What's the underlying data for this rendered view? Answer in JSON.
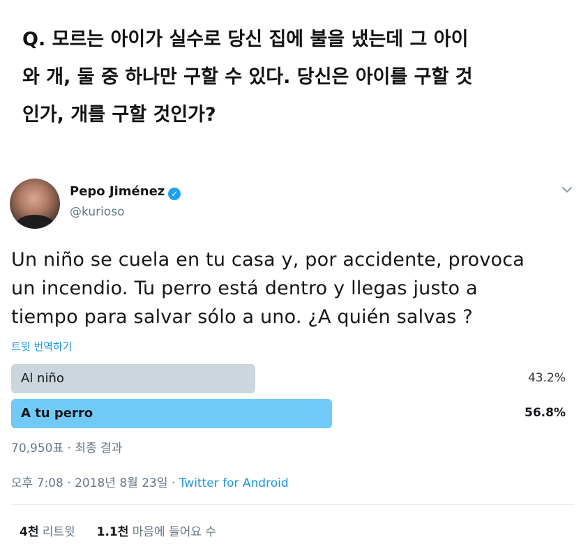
{
  "question": {
    "line1": "Q. 모르는 아이가 실수로 당신 집에 불을 냈는데 그 아이",
    "line2": "와 개, 둘 중 하나만 구할 수 있다. 당신은 아이를 구할 것",
    "line3": "인가, 개를 구할 것인가?"
  },
  "tweet": {
    "author_name": "Pepo Jiménez",
    "author_handle": "@kurioso",
    "verified_mark": "✓",
    "text_line1": "Un niño se cuela en tu casa y, por accidente, provoca",
    "text_line2": "un incendio. Tu perro está dentro y llegas justo a",
    "text_line3": "tiempo para salvar sólo a uno. ¿A quién salvas ?",
    "translate_label": "트윗 번역하기"
  },
  "poll": {
    "options": [
      {
        "label": "Al niño",
        "percent_text": "43.2%",
        "percent": 43.2,
        "winner": false
      },
      {
        "label": "A tu perro",
        "percent_text": "56.8%",
        "percent": 56.8,
        "winner": true
      }
    ],
    "summary": "70,950표 · 최종 결과"
  },
  "meta": {
    "time_date": "오후 7:08 · 2018년 8월 23일 · ",
    "source": "Twitter for Android"
  },
  "stats": {
    "retweets_count": "4천",
    "retweets_label": "리트윗",
    "likes_count": "1.1천",
    "likes_label": "마음에 들어요 수"
  },
  "icons": {
    "verified": "verified-badge-icon",
    "menu": "chevron-down-icon"
  },
  "colors": {
    "accent": "#1da1f2",
    "link": "#1b95e0",
    "poll_loser": "#ccd6dd",
    "poll_winner": "#71c9f8",
    "muted_text": "#657786"
  }
}
